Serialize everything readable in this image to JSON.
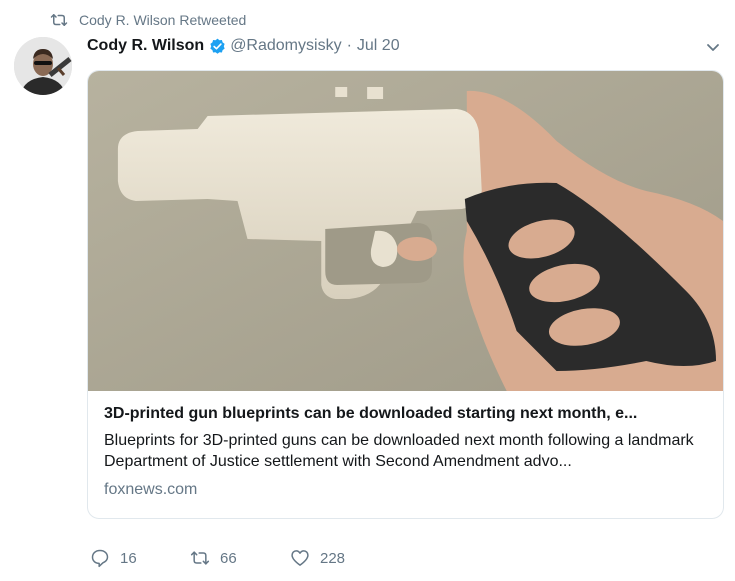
{
  "retweet_bar": {
    "text": "Cody R. Wilson Retweeted"
  },
  "tweet": {
    "author_name": "Cody R. Wilson",
    "handle": "@Radomysisky",
    "separator": "·",
    "date": "Jul 20"
  },
  "card": {
    "title": "3D-printed gun blueprints can be downloaded starting next month, e...",
    "description": "Blueprints for 3D-printed guns can be downloaded next month following a landmark Department of Justice settlement with Second Amendment advo...",
    "domain": "foxnews.com"
  },
  "actions": {
    "replies": "16",
    "retweets": "66",
    "likes": "228"
  },
  "colors": {
    "secondary_text": "#657786",
    "verified_blue": "#1da1f2",
    "border": "#e1e8ed"
  },
  "icons": [
    "retweet-icon",
    "verified-badge-icon",
    "chevron-down-icon",
    "reply-icon",
    "retweet-icon",
    "heart-icon"
  ]
}
